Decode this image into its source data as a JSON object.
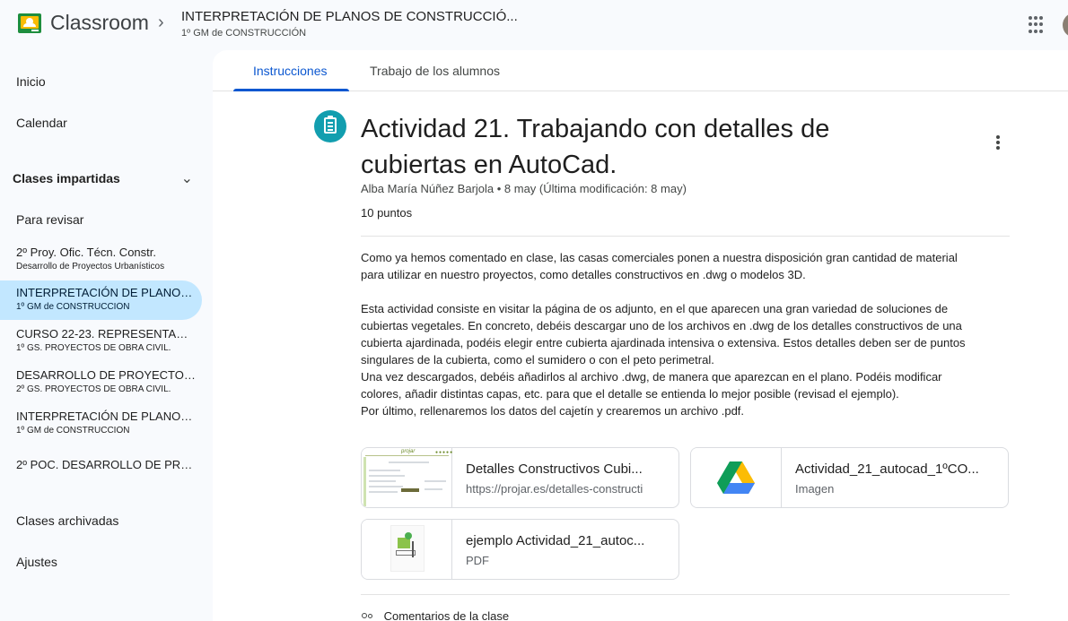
{
  "header": {
    "app_title": "Classroom",
    "course_title": "INTERPRETACIÓN DE PLANOS DE CONSTRUCCIÓ...",
    "course_section": "1º GM de CONSTRUCCIÓN"
  },
  "sidebar": {
    "inicio": "Inicio",
    "calendario": "Calendar",
    "section_title": "Clases impartidas",
    "para_revisar": "Para revisar",
    "classes": [
      {
        "name": "2º Proy. Ofic. Técn. Constr.",
        "section": "Desarrollo de Proyectos Urbanísticos"
      },
      {
        "name": "INTERPRETACIÓN DE PLANOS...",
        "section": "1º GM de CONSTRUCCIÓN"
      },
      {
        "name": "CURSO 22-23. REPRESENTACI...",
        "section": "1º GS. PROYECTOS DE OBRA CIVIL."
      },
      {
        "name": "DESARROLLO DE PROYECTOS...",
        "section": "2º GS. PROYECTOS DE OBRA CIVIL."
      },
      {
        "name": "INTERPRETACIÓN DE PLANOS...",
        "section": "1º GM de CONSTRUCCIÓN"
      },
      {
        "name": "2º POC. DESARROLLO DE PRO...",
        "section": ""
      }
    ],
    "archivadas": "Clases archivadas",
    "ajustes": "Ajustes"
  },
  "tabs": [
    "Instrucciones",
    "Trabajo de los alumnos"
  ],
  "assignment": {
    "title": "Actividad 21. Trabajando con detalles de cubiertas en AutoCad.",
    "meta": "Alba María Núñez Barjola • 8 may (Última modificación: 8 may)",
    "points": "10 puntos",
    "description": "Como ya hemos comentado en clase, las casas comerciales ponen a nuestra disposición gran cantidad de material\npara utilizar en nuestro proyectos, como detalles constructivos en .dwg o modelos 3D.\n\nEsta actividad consiste en visitar la página de os adjunto, en el que aparecen una gran variedad de soluciones de\ncubiertas vegetales. En concreto, debéis descargar uno de los archivos en .dwg de los detalles constructivos de una\ncubierta ajardinada, podéis elegir entre cubierta ajardinada intensiva o extensiva. Estos detalles deben ser de puntos\nsingulares de la cubierta, como el sumidero o con el peto perimetral.\nUna vez descargados, debéis añadirlos al archivo .dwg, de manera que aparezcan en el plano. Podéis modificar\ncolores, añadir distintas capas, etc. para que el detalle se entienda lo mejor posible (revisad el ejemplo).\nPor último, rellenaremos los datos del cajetín y crearemos un archivo .pdf.",
    "attachments": [
      {
        "name": "Detalles Constructivos Cubi...",
        "kind": "https://projar.es/detalles-constructi",
        "thumb_logo": "projar",
        "thumb_dots": "●●●●●"
      },
      {
        "name": "Actividad_21_autocad_1ºCO...",
        "kind": "Imagen",
        "icon": "google-drive-icon"
      },
      {
        "name": "ejemplo Actividad_21_autoc...",
        "kind": "PDF"
      }
    ],
    "comments_label": "Comentarios de la clase"
  },
  "colors": {
    "accent": "#0b57d0",
    "active_class_bg": "#c2e7ff",
    "assignment_icon": "#129eaf"
  }
}
